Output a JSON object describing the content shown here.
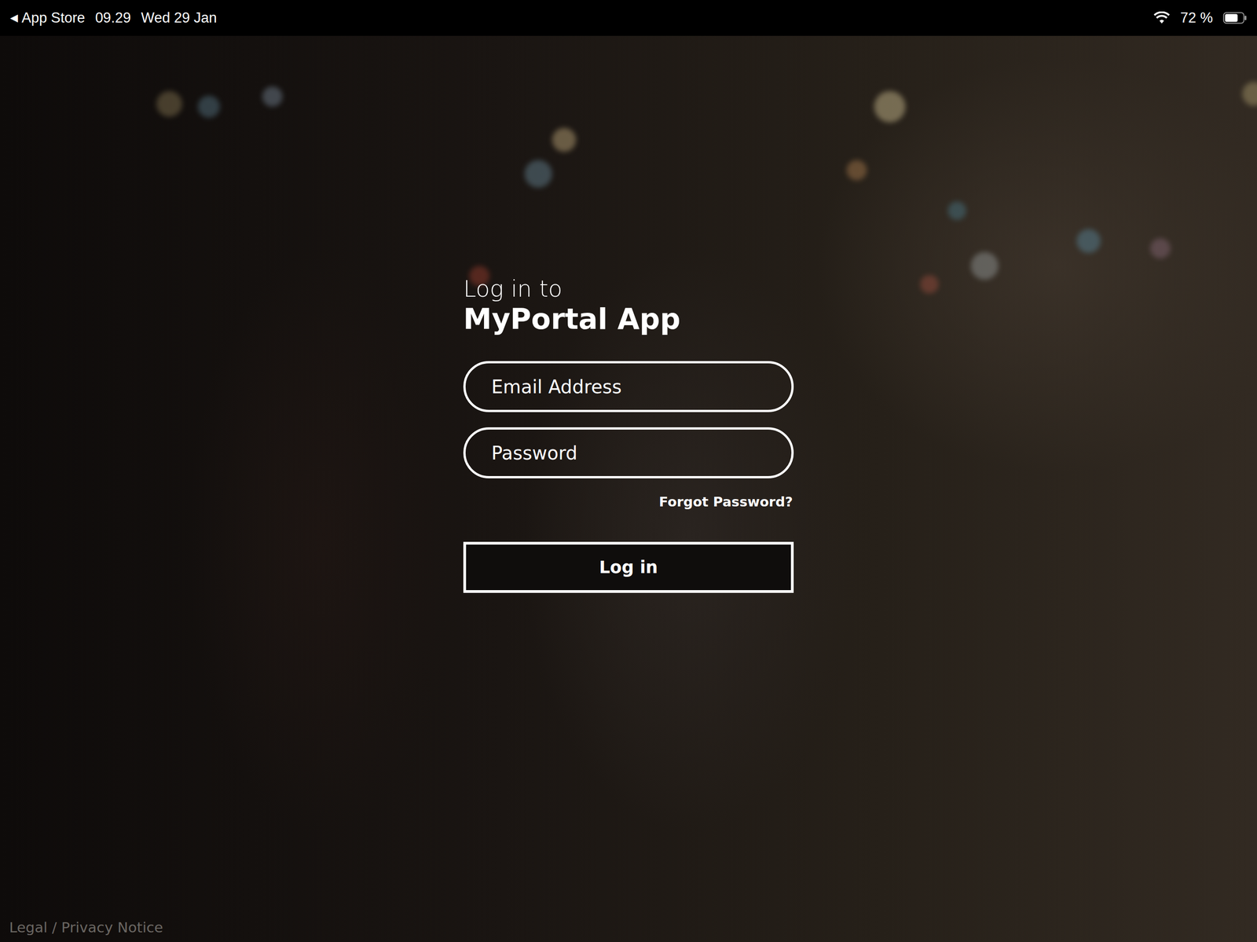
{
  "status_bar": {
    "back": "◀",
    "app": "App Store",
    "time": "09.29",
    "date": "Wed 29 Jan",
    "battery_text": "72 %",
    "battery_level": 0.72
  },
  "login": {
    "heading": "Log in to",
    "app_name": "MyPortal App",
    "email": {
      "placeholder": "Email Address"
    },
    "password": {
      "placeholder": "Password"
    },
    "forgot": "Forgot Password?",
    "button": "Log in"
  },
  "footer": {
    "legal": "Legal / Privacy Notice"
  }
}
